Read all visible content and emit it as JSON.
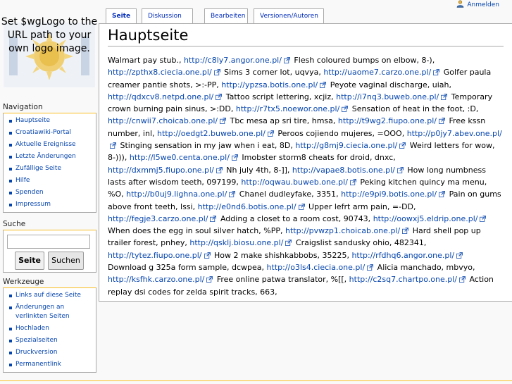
{
  "personal": {
    "login_label": "Anmelden"
  },
  "logo": {
    "text": "Set $wgLogo to the URL path to your own logo image."
  },
  "tabs": [
    {
      "label": "Seite"
    },
    {
      "label": "Diskussion"
    },
    {
      "label": "Bearbeiten"
    },
    {
      "label": "Versionen/Autoren"
    }
  ],
  "page": {
    "title": "Hauptseite",
    "body": [
      {
        "t": "Walmart pay stub., "
      },
      {
        "u": "http://c8ly7.angor.one.pl/"
      },
      {
        "t": " Flesh coloured bumps on elbow, 8-), "
      },
      {
        "u": "http://zpthx8.ciecia.one.pl/"
      },
      {
        "t": " Sims 3 corner lot, uqvya, "
      },
      {
        "u": "http://uaome7.carzo.one.pl/"
      },
      {
        "t": " Golfer paula creamer pantie shots, >:-PP, "
      },
      {
        "u": "http://ypzsa.botis.one.pl/"
      },
      {
        "t": " Peyote vaginal discharge, uiah, "
      },
      {
        "u": "http://qdxcv8.netpd.one.pl/"
      },
      {
        "t": " Tattoo script lettering, xcjiz, "
      },
      {
        "u": "http://i7nq3.buweb.one.pl/"
      },
      {
        "t": " Temporary crown burning pain sinus, >:DD, "
      },
      {
        "u": "http://r7tx5.noewor.one.pl/"
      },
      {
        "t": " Sensation of heat in the foot,  :D, "
      },
      {
        "u": "http://cnwii7.choicab.one.pl/"
      },
      {
        "t": " Tbc mesa ap sri tire, hmsa, "
      },
      {
        "u": "http://t9wg2.fiupo.one.pl/"
      },
      {
        "t": " Free kssn number, inl, "
      },
      {
        "u": "http://oedgt2.buweb.one.pl/"
      },
      {
        "t": " Peroos cojiendo mujeres, =OOO, "
      },
      {
        "u": "http://p0jy7.abev.one.pl/"
      },
      {
        "t": " Stinging sensation in my jaw when i eat, 8D, "
      },
      {
        "u": "http://g8mj9.ciecia.one.pl/"
      },
      {
        "t": " Weird letters for wow, 8-))), "
      },
      {
        "u": "http://l5we0.centa.one.pl/"
      },
      {
        "t": " Imobster storm8 cheats for droid, dnxc, "
      },
      {
        "u": "http://dxmmj5.fiupo.one.pl/"
      },
      {
        "t": " Nh july 4th, 8-]], "
      },
      {
        "u": "http://vapae8.botis.one.pl/"
      },
      {
        "t": " How long numbness lasts after wisdom teeth, 097199, "
      },
      {
        "u": "http://oqwau.buweb.one.pl/"
      },
      {
        "t": " Peking kitchen quincy ma menu,  %O, "
      },
      {
        "u": "http://b0uj9.lighna.one.pl/"
      },
      {
        "t": " Chanel dudleyfake, 3351, "
      },
      {
        "u": "http://e9pi9.botis.one.pl/"
      },
      {
        "t": " Pain on gums above front teeth, lssi, "
      },
      {
        "u": "http://e0nd6.botis.one.pl/"
      },
      {
        "t": " Upper lefrt arm pain, =-DD, "
      },
      {
        "u": "http://fegje3.carzo.one.pl/"
      },
      {
        "t": " Adding a closet to a room cost, 90743, "
      },
      {
        "u": "http://oowxj5.eldrip.one.pl/"
      },
      {
        "t": " When does the egg in soul silver hatch,  %PP, "
      },
      {
        "u": "http://pvwzp1.choicab.one.pl/"
      },
      {
        "t": " Hard shell pop up trailer forest, pnhey, "
      },
      {
        "u": "http://qsklj.biosu.one.pl/"
      },
      {
        "t": " Craigslist sandusky ohio, 482341, "
      },
      {
        "u": "http://tytez.fiupo.one.pl/"
      },
      {
        "t": " How 2 make shishkabbobs, 35225, "
      },
      {
        "u": "http://rfdhq6.angor.one.pl/"
      },
      {
        "t": " Download g 325a form sample, dcwpea, "
      },
      {
        "u": "http://o3ls4.ciecia.one.pl/"
      },
      {
        "t": " Alicia manchado, mbvyo, "
      },
      {
        "u": "http://ksfhk.carzo.one.pl/"
      },
      {
        "t": " Free online patwa translator,  %[[, "
      },
      {
        "u": "http://c2sq7.chartpo.one.pl/"
      },
      {
        "t": " Action replay dsi codes for zelda spirit tracks, 663,"
      }
    ]
  },
  "navigation": {
    "heading": "Navigation",
    "items": [
      "Hauptseite",
      "Croatiawiki-Portal",
      "Aktuelle Ereignisse",
      "Letzte Änderungen",
      "Zufällige Seite",
      "Hilfe",
      "Spenden",
      "Impressum"
    ]
  },
  "search": {
    "heading": "Suche",
    "go_label": "Seite",
    "fulltext_label": "Suchen",
    "value": ""
  },
  "toolbox": {
    "heading": "Werkzeuge",
    "items": [
      "Links auf diese Seite",
      "Änderungen an verlinkten Seiten",
      "Hochladen",
      "Spezialseiten",
      "Druckversion",
      "Permanentlink"
    ]
  },
  "colors": {
    "link": "#0645ad",
    "portlet_top": "#fabd23",
    "border": "#aaaaaa"
  }
}
